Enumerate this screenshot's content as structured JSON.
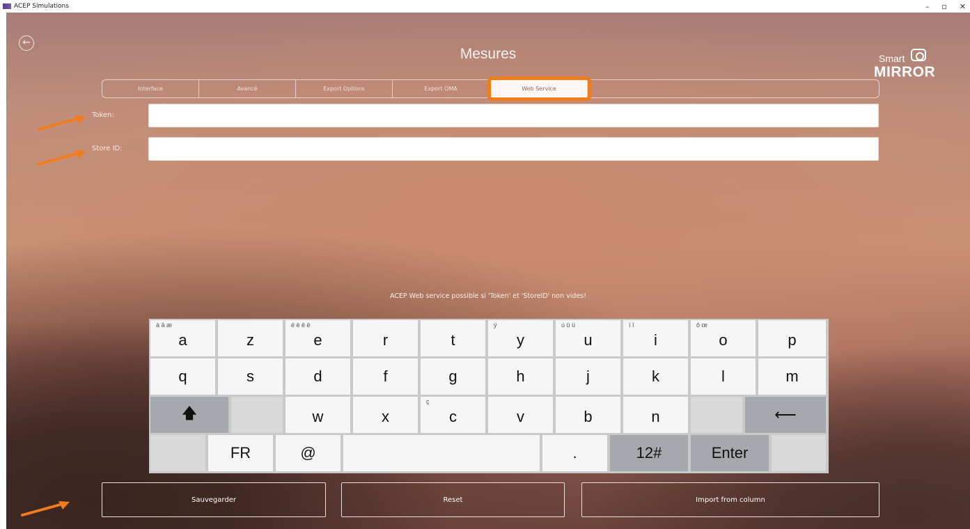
{
  "window": {
    "title": "ACEP Simulations",
    "controls": [
      "–",
      "▫",
      "✕"
    ]
  },
  "header": {
    "back_icon": "←",
    "title": "Mesures",
    "logo_smart": "Smart",
    "logo_mirror": "MIRROR"
  },
  "tabs": [
    {
      "label": "Interface",
      "active": false
    },
    {
      "label": "Avancé",
      "active": false
    },
    {
      "label": "Export Options",
      "active": false
    },
    {
      "label": "Export OMA",
      "active": false
    },
    {
      "label": "Web Service",
      "active": true
    }
  ],
  "form": {
    "token_label": "Token:",
    "token_value": "",
    "store_label": "Store ID:",
    "store_value": ""
  },
  "notice": "ACEP Web service possible si 'Token' et 'StoreID' non vides!",
  "keyboard": {
    "row1": [
      {
        "main": "a",
        "acc": "à â æ"
      },
      {
        "main": "z",
        "acc": ""
      },
      {
        "main": "e",
        "acc": "é è ê ë"
      },
      {
        "main": "r",
        "acc": ""
      },
      {
        "main": "t",
        "acc": ""
      },
      {
        "main": "y",
        "acc": "ÿ"
      },
      {
        "main": "u",
        "acc": "ù û ü"
      },
      {
        "main": "i",
        "acc": "ï î"
      },
      {
        "main": "o",
        "acc": "ô œ"
      },
      {
        "main": "p",
        "acc": ""
      }
    ],
    "row2": [
      "q",
      "s",
      "d",
      "f",
      "g",
      "h",
      "j",
      "k",
      "l",
      "m"
    ],
    "row3": [
      {
        "main": "w",
        "acc": ""
      },
      {
        "main": "x",
        "acc": ""
      },
      {
        "main": "c",
        "acc": "ç"
      },
      {
        "main": "v",
        "acc": ""
      },
      {
        "main": "b",
        "acc": ""
      },
      {
        "main": "n",
        "acc": ""
      }
    ],
    "shift": "🡅",
    "backspace": "⟵",
    "lang": "FR",
    "at": "@",
    "space": "",
    "dot": ".",
    "numbers": "12#",
    "enter": "Enter"
  },
  "buttons": {
    "save": "Sauvegarder",
    "reset": "Reset",
    "import": "Import from column"
  },
  "colors": {
    "highlight": "#f07c1e",
    "annotation_arrow": "#f07c1e"
  }
}
